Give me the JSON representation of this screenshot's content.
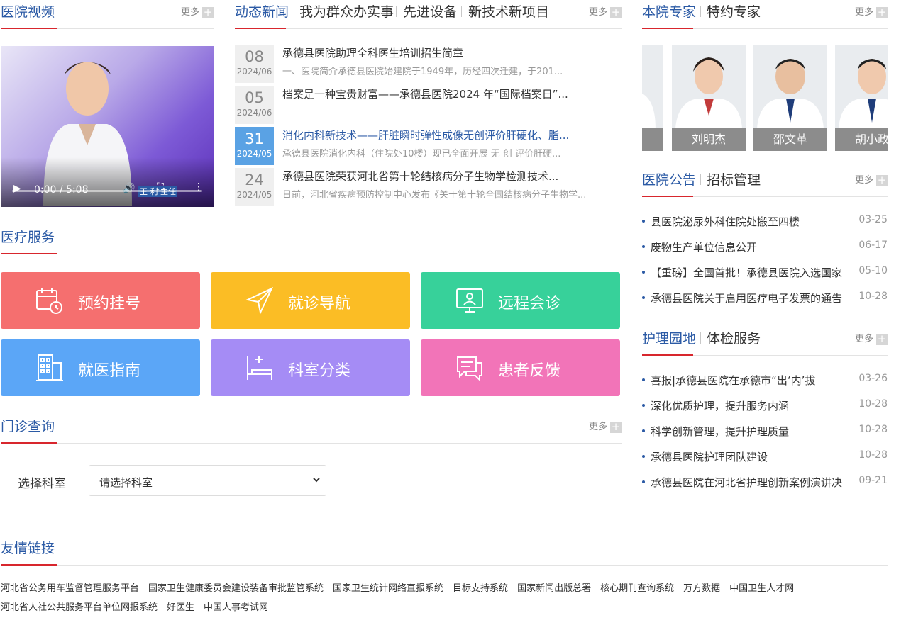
{
  "video_section": {
    "title": "医院视频",
    "more": "更多",
    "time": "0:00 / 5:08",
    "caption": "王 利  主任"
  },
  "news_section": {
    "tabs": [
      "动态新闻",
      "我为群众办实事",
      "先进设备",
      "新技术新项目"
    ],
    "more": "更多",
    "items": [
      {
        "day": "08",
        "ym": "2024/06",
        "title": "承德县医院助理全科医生培训招生简章",
        "summary": "一、医院简介承德县医院始建院于1949年，历经四次迁建，于201..."
      },
      {
        "day": "05",
        "ym": "2024/06",
        "title": "档案是一种宝贵财富——承德县医院2024 年“国际档案日”...",
        "summary": ""
      },
      {
        "day": "31",
        "ym": "2024/05",
        "title": "消化内科新技术——肝脏瞬时弹性成像无创评价肝硬化、脂...",
        "summary": "承德县医院消化内科（住院处10楼）现已全面开展 无 创 评价肝硬..."
      },
      {
        "day": "24",
        "ym": "2024/05",
        "title": "承德县医院荣获河北省第十轮结核病分子生物学检测技术...",
        "summary": "日前，河北省疾病预防控制中心发布《关于第十轮全国结核病分子生物学..."
      }
    ]
  },
  "medical_service": {
    "title": "医疗服务",
    "tiles": [
      {
        "label": "预约挂号",
        "icon": "calendar-clock-icon",
        "color": "#f56f6f"
      },
      {
        "label": "就诊导航",
        "icon": "navigation-arrow-icon",
        "color": "#fbbd25"
      },
      {
        "label": "远程会诊",
        "icon": "monitor-person-icon",
        "color": "#37d19a"
      },
      {
        "label": "就医指南",
        "icon": "building-icon",
        "color": "#5ba6f7"
      },
      {
        "label": "科室分类",
        "icon": "hospital-bed-icon",
        "color": "#a58cf5"
      },
      {
        "label": "患者反馈",
        "icon": "chat-bubbles-icon",
        "color": "#f274b8"
      }
    ]
  },
  "outpatient": {
    "title": "门诊查询",
    "more": "更多",
    "label": "选择科室",
    "select_value": "请选择科室"
  },
  "experts_section": {
    "tabs": [
      "本院专家",
      "特约专家"
    ],
    "more": "更多",
    "names": [
      "刘明杰",
      "邵文革",
      "胡小政"
    ]
  },
  "notice_section": {
    "tabs": [
      "医院公告",
      "招标管理"
    ],
    "more": "更多",
    "items": [
      {
        "title": "县医院泌尿外科住院处搬至四楼",
        "date": "03-25"
      },
      {
        "title": "废物生产单位信息公开",
        "date": "06-17"
      },
      {
        "title": "【重磅】全国首批！承德县医院入选国家",
        "date": "05-10"
      },
      {
        "title": "承德县医院关于启用医疗电子发票的通告",
        "date": "10-28"
      }
    ]
  },
  "nursing_section": {
    "tabs": [
      "护理园地",
      "体检服务"
    ],
    "more": "更多",
    "items": [
      {
        "title": "喜报|承德县医院在承德市“出‘内’拔",
        "date": "03-26"
      },
      {
        "title": "深化优质护理，提升服务内涵",
        "date": "10-28"
      },
      {
        "title": "科学创新管理，提升护理质量",
        "date": "10-28"
      },
      {
        "title": "承德县医院护理团队建设",
        "date": "10-28"
      },
      {
        "title": "承德县医院在河北省护理创新案例演讲决",
        "date": "09-21"
      }
    ]
  },
  "links_section": {
    "title": "友情链接",
    "links": [
      "河北省公务用车监督管理服务平台",
      "国家卫生健康委员会建设装备审批监管系统",
      "国家卫生统计网络直报系统",
      "目标支持系统",
      "国家新闻出版总署",
      "核心期刊查询系统",
      "万方数据",
      "中国卫生人才网",
      "河北省人社公共服务平台单位网报系统",
      "好医生",
      "中国人事考试网"
    ]
  }
}
